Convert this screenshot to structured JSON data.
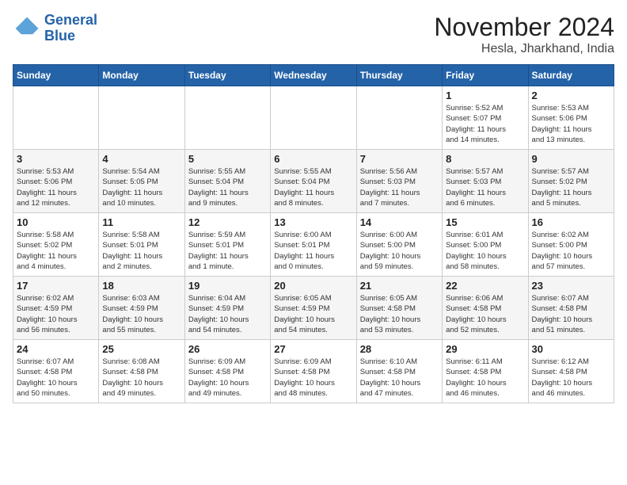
{
  "logo": {
    "line1": "General",
    "line2": "Blue"
  },
  "header": {
    "month": "November 2024",
    "location": "Hesla, Jharkhand, India"
  },
  "weekdays": [
    "Sunday",
    "Monday",
    "Tuesday",
    "Wednesday",
    "Thursday",
    "Friday",
    "Saturday"
  ],
  "weeks": [
    [
      {
        "day": "",
        "info": ""
      },
      {
        "day": "",
        "info": ""
      },
      {
        "day": "",
        "info": ""
      },
      {
        "day": "",
        "info": ""
      },
      {
        "day": "",
        "info": ""
      },
      {
        "day": "1",
        "info": "Sunrise: 5:52 AM\nSunset: 5:07 PM\nDaylight: 11 hours\nand 14 minutes."
      },
      {
        "day": "2",
        "info": "Sunrise: 5:53 AM\nSunset: 5:06 PM\nDaylight: 11 hours\nand 13 minutes."
      }
    ],
    [
      {
        "day": "3",
        "info": "Sunrise: 5:53 AM\nSunset: 5:06 PM\nDaylight: 11 hours\nand 12 minutes."
      },
      {
        "day": "4",
        "info": "Sunrise: 5:54 AM\nSunset: 5:05 PM\nDaylight: 11 hours\nand 10 minutes."
      },
      {
        "day": "5",
        "info": "Sunrise: 5:55 AM\nSunset: 5:04 PM\nDaylight: 11 hours\nand 9 minutes."
      },
      {
        "day": "6",
        "info": "Sunrise: 5:55 AM\nSunset: 5:04 PM\nDaylight: 11 hours\nand 8 minutes."
      },
      {
        "day": "7",
        "info": "Sunrise: 5:56 AM\nSunset: 5:03 PM\nDaylight: 11 hours\nand 7 minutes."
      },
      {
        "day": "8",
        "info": "Sunrise: 5:57 AM\nSunset: 5:03 PM\nDaylight: 11 hours\nand 6 minutes."
      },
      {
        "day": "9",
        "info": "Sunrise: 5:57 AM\nSunset: 5:02 PM\nDaylight: 11 hours\nand 5 minutes."
      }
    ],
    [
      {
        "day": "10",
        "info": "Sunrise: 5:58 AM\nSunset: 5:02 PM\nDaylight: 11 hours\nand 4 minutes."
      },
      {
        "day": "11",
        "info": "Sunrise: 5:58 AM\nSunset: 5:01 PM\nDaylight: 11 hours\nand 2 minutes."
      },
      {
        "day": "12",
        "info": "Sunrise: 5:59 AM\nSunset: 5:01 PM\nDaylight: 11 hours\nand 1 minute."
      },
      {
        "day": "13",
        "info": "Sunrise: 6:00 AM\nSunset: 5:01 PM\nDaylight: 11 hours\nand 0 minutes."
      },
      {
        "day": "14",
        "info": "Sunrise: 6:00 AM\nSunset: 5:00 PM\nDaylight: 10 hours\nand 59 minutes."
      },
      {
        "day": "15",
        "info": "Sunrise: 6:01 AM\nSunset: 5:00 PM\nDaylight: 10 hours\nand 58 minutes."
      },
      {
        "day": "16",
        "info": "Sunrise: 6:02 AM\nSunset: 5:00 PM\nDaylight: 10 hours\nand 57 minutes."
      }
    ],
    [
      {
        "day": "17",
        "info": "Sunrise: 6:02 AM\nSunset: 4:59 PM\nDaylight: 10 hours\nand 56 minutes."
      },
      {
        "day": "18",
        "info": "Sunrise: 6:03 AM\nSunset: 4:59 PM\nDaylight: 10 hours\nand 55 minutes."
      },
      {
        "day": "19",
        "info": "Sunrise: 6:04 AM\nSunset: 4:59 PM\nDaylight: 10 hours\nand 54 minutes."
      },
      {
        "day": "20",
        "info": "Sunrise: 6:05 AM\nSunset: 4:59 PM\nDaylight: 10 hours\nand 54 minutes."
      },
      {
        "day": "21",
        "info": "Sunrise: 6:05 AM\nSunset: 4:58 PM\nDaylight: 10 hours\nand 53 minutes."
      },
      {
        "day": "22",
        "info": "Sunrise: 6:06 AM\nSunset: 4:58 PM\nDaylight: 10 hours\nand 52 minutes."
      },
      {
        "day": "23",
        "info": "Sunrise: 6:07 AM\nSunset: 4:58 PM\nDaylight: 10 hours\nand 51 minutes."
      }
    ],
    [
      {
        "day": "24",
        "info": "Sunrise: 6:07 AM\nSunset: 4:58 PM\nDaylight: 10 hours\nand 50 minutes."
      },
      {
        "day": "25",
        "info": "Sunrise: 6:08 AM\nSunset: 4:58 PM\nDaylight: 10 hours\nand 49 minutes."
      },
      {
        "day": "26",
        "info": "Sunrise: 6:09 AM\nSunset: 4:58 PM\nDaylight: 10 hours\nand 49 minutes."
      },
      {
        "day": "27",
        "info": "Sunrise: 6:09 AM\nSunset: 4:58 PM\nDaylight: 10 hours\nand 48 minutes."
      },
      {
        "day": "28",
        "info": "Sunrise: 6:10 AM\nSunset: 4:58 PM\nDaylight: 10 hours\nand 47 minutes."
      },
      {
        "day": "29",
        "info": "Sunrise: 6:11 AM\nSunset: 4:58 PM\nDaylight: 10 hours\nand 46 minutes."
      },
      {
        "day": "30",
        "info": "Sunrise: 6:12 AM\nSunset: 4:58 PM\nDaylight: 10 hours\nand 46 minutes."
      }
    ]
  ]
}
